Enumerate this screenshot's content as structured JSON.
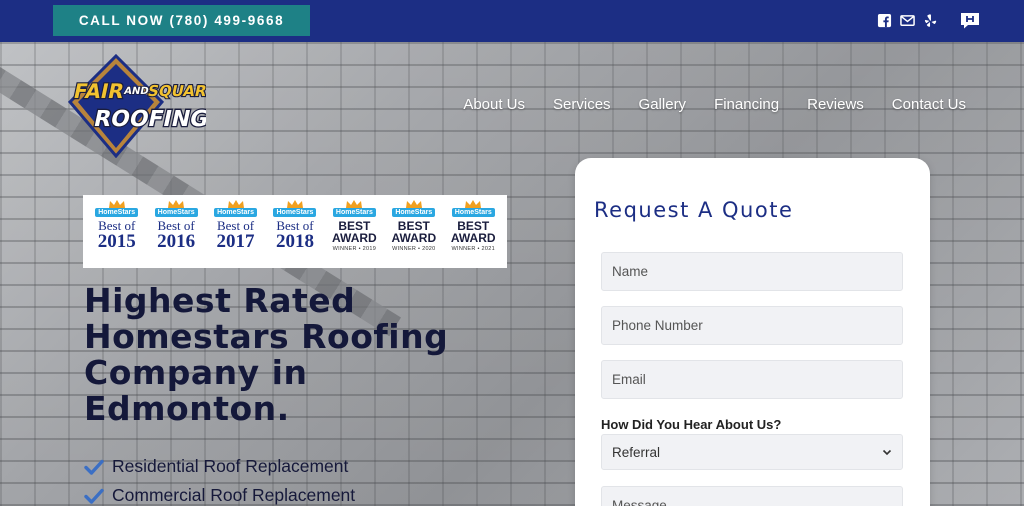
{
  "topbar": {
    "call_label": "CALL NOW (780) 499-9668",
    "social_icons": [
      "facebook-icon",
      "email-icon",
      "yelp-icon",
      "homestars-icon"
    ],
    "bg_color": "#1c2e84",
    "call_color": "#1e8186"
  },
  "logo": {
    "line1_left": "FAIR",
    "line1_mid": "AND",
    "line1_right": "SQUARE",
    "line2": "ROOFING"
  },
  "nav": {
    "items": [
      "About Us",
      "Services",
      "Gallery",
      "Financing",
      "Reviews",
      "Contact Us"
    ]
  },
  "awards": [
    {
      "tag": "HomeStars",
      "text": "Best of",
      "year": "2015"
    },
    {
      "tag": "HomeStars",
      "text": "Best of",
      "year": "2016"
    },
    {
      "tag": "HomeStars",
      "text": "Best of",
      "year": "2017"
    },
    {
      "tag": "HomeStars",
      "text": "Best of",
      "year": "2018"
    },
    {
      "tag": "HomeStars",
      "text": "BEST AWARD",
      "winner": "WINNER • 2019"
    },
    {
      "tag": "HomeStars",
      "text": "BEST AWARD",
      "winner": "WINNER • 2020"
    },
    {
      "tag": "HomeStars",
      "text": "BEST AWARD",
      "winner": "WINNER • 2021"
    }
  ],
  "hero": {
    "headline_l1": "Highest Rated",
    "headline_l2": "Homestars Roofing",
    "headline_l3": "Company in",
    "headline_l4": "Edmonton.",
    "checks": [
      "Residential Roof Replacement",
      "Commercial Roof Replacement"
    ]
  },
  "quote": {
    "title": "Request A Quote",
    "name_placeholder": "Name",
    "phone_placeholder": "Phone Number",
    "email_placeholder": "Email",
    "hear_label": "How Did You Hear About Us?",
    "hear_selected": "Referral",
    "message_placeholder": "Message"
  }
}
